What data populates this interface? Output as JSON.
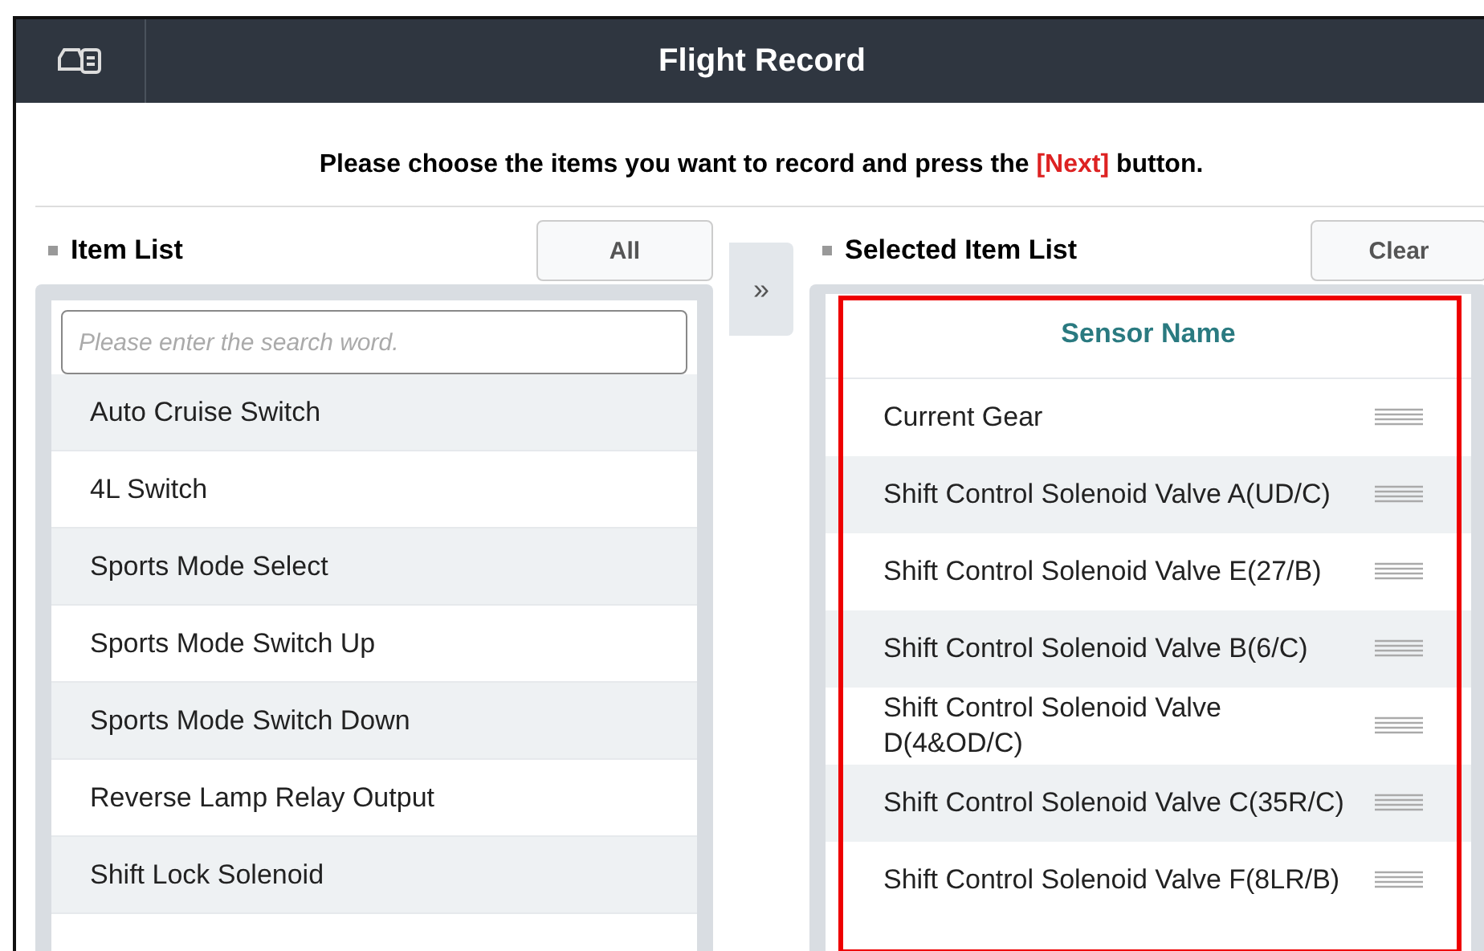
{
  "window": {
    "title": "Flight Record"
  },
  "instruction": "Please choose the items you want to record and press the **[Next]** button.",
  "item_list": {
    "title": "Item List",
    "button": "All",
    "search": {
      "placeholder": "Please enter the search word."
    },
    "move_button": "»",
    "items": [
      {
        "label": "Auto Cruise Switch"
      },
      {
        "label": "4L Switch"
      },
      {
        "label": "Sports Mode Select"
      },
      {
        "label": "Sports Mode Switch Up"
      },
      {
        "label": "Sports Mode Switch Down"
      },
      {
        "label": "Reverse Lamp Relay Output"
      },
      {
        "label": "Shift Lock Solenoid"
      }
    ]
  },
  "selected_list": {
    "title": "Selected Item List",
    "button": "Clear",
    "column": "Sensor Name",
    "items": [
      {
        "label": "Current Gear"
      },
      {
        "label": "Shift Control Solenoid Valve A(UD/C)"
      },
      {
        "label": "Shift Control Solenoid Valve E(27/B)"
      },
      {
        "label": "Shift Control Solenoid Valve B(6/C)"
      },
      {
        "label": "Shift Control Solenoid Valve D(4&OD/C)"
      },
      {
        "label": "Shift Control Solenoid Valve C(35R/C)"
      },
      {
        "label": "Shift Control Solenoid Valve F(8LR/B)"
      }
    ]
  }
}
